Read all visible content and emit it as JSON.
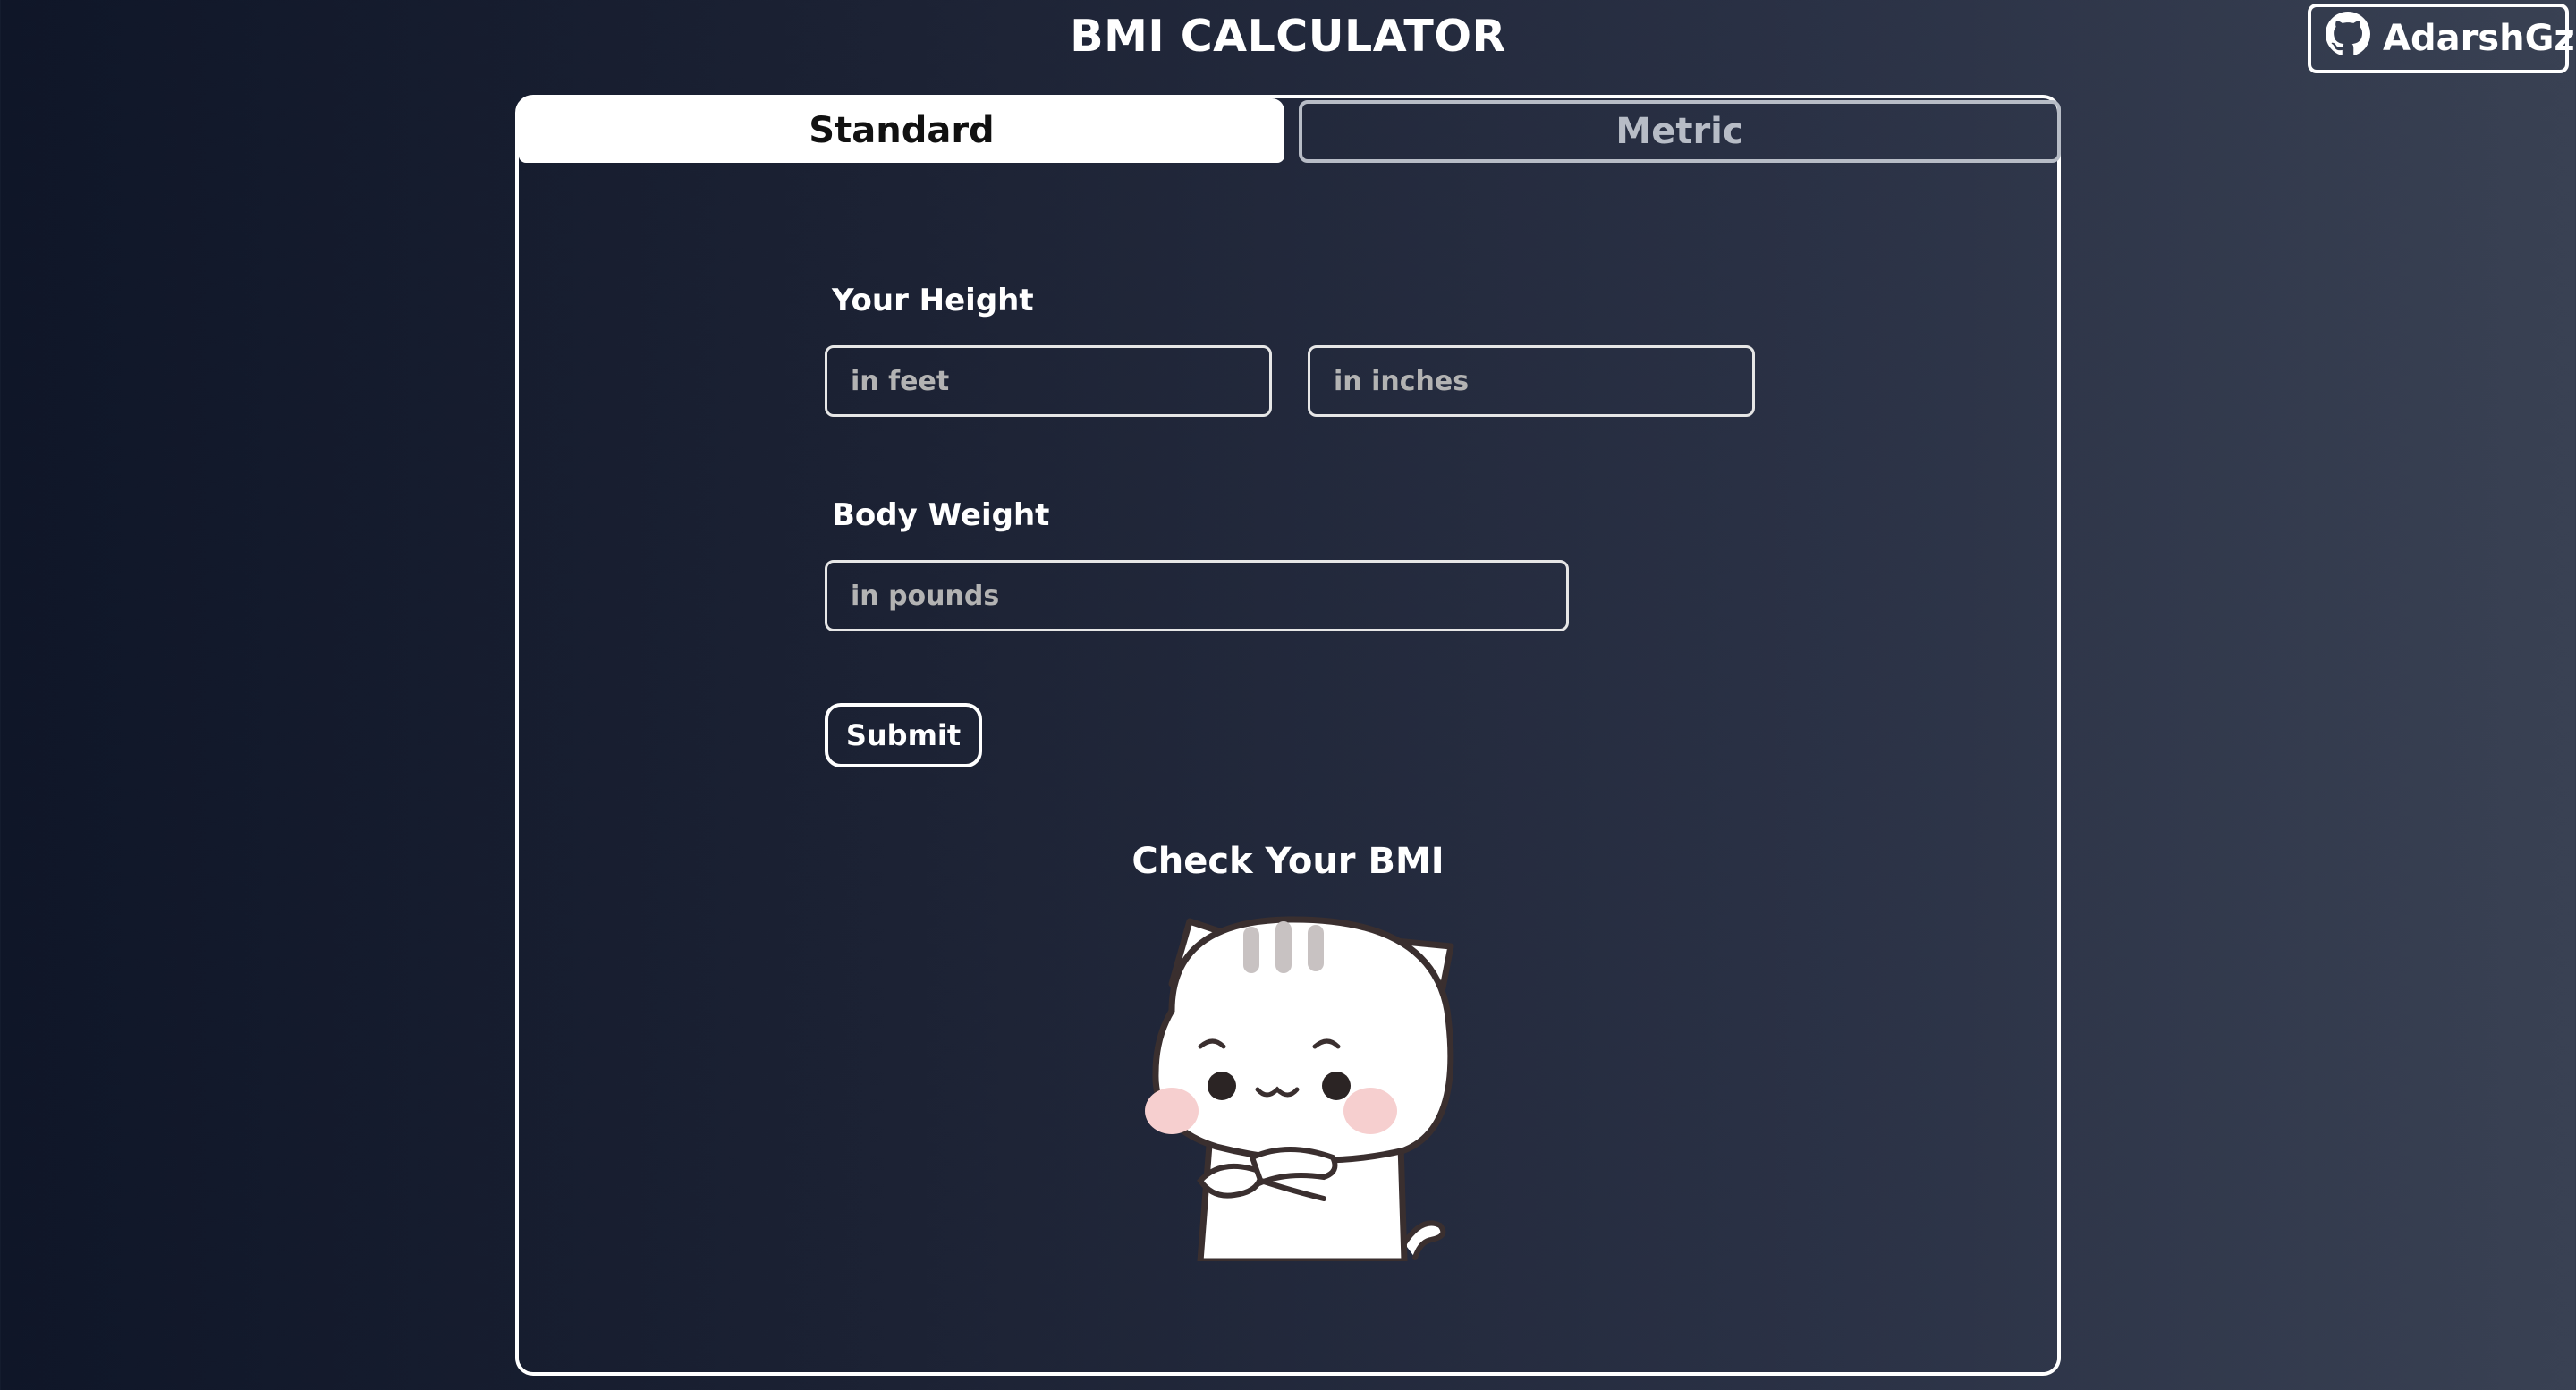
{
  "header": {
    "title": "BMI CALCULATOR",
    "github_label": "AdarshGzz",
    "github_icon": "github-icon"
  },
  "tabs": [
    {
      "label": "Standard",
      "active": true
    },
    {
      "label": "Metric",
      "active": false
    }
  ],
  "form": {
    "height": {
      "label": "Your Height",
      "feet_placeholder": "in feet",
      "inches_placeholder": "in inches",
      "feet_value": "",
      "inches_value": ""
    },
    "weight": {
      "label": "Body Weight",
      "pounds_placeholder": "in pounds",
      "pounds_value": ""
    },
    "submit_label": "Submit"
  },
  "result": {
    "title": "Check Your BMI",
    "image": "cat-sticker"
  },
  "colors": {
    "background_start": "#0f1628",
    "background_end": "#394153",
    "active_tab_bg": "#ffffff",
    "active_tab_text": "#111111",
    "inactive_tab_text": "#b7bcc6",
    "placeholder": "#b3b3b3"
  }
}
